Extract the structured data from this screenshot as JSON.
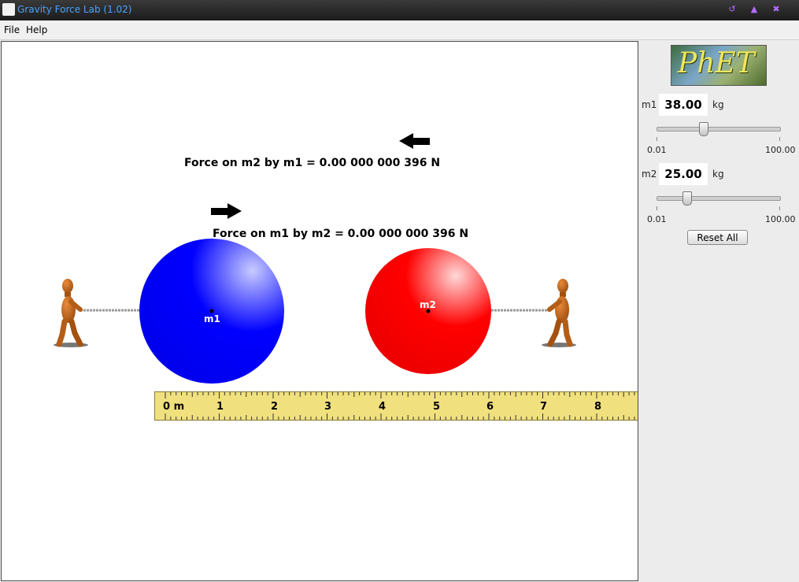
{
  "window": {
    "title": "Gravity Force Lab (1.02)"
  },
  "menu": {
    "file": "File",
    "help": "Help"
  },
  "logo": {
    "text": "PhET"
  },
  "forces": {
    "on_m2": "Force on m2 by m1 = 0.00 000 000 396  N",
    "on_m1": "Force on m1 by m2 = 0.00 000 000 396  N"
  },
  "masses": {
    "m1_label": "m1",
    "m2_label": "m2"
  },
  "controls": {
    "m1": {
      "label": "m1",
      "value": "38.00",
      "unit": "kg",
      "min": "0.01",
      "max": "100.00",
      "slider_value": 38.0
    },
    "m2": {
      "label": "m2",
      "value": "25.00",
      "unit": "kg",
      "min": "0.01",
      "max": "100.00",
      "slider_value": 25.0
    },
    "reset": "Reset All"
  },
  "ruler": {
    "labels": [
      "0 m",
      "1",
      "2",
      "3",
      "4",
      "5",
      "6",
      "7",
      "8"
    ]
  },
  "colors": {
    "m1": "#0000ff",
    "m2": "#ff0000",
    "ruler": "#f0e07e"
  }
}
